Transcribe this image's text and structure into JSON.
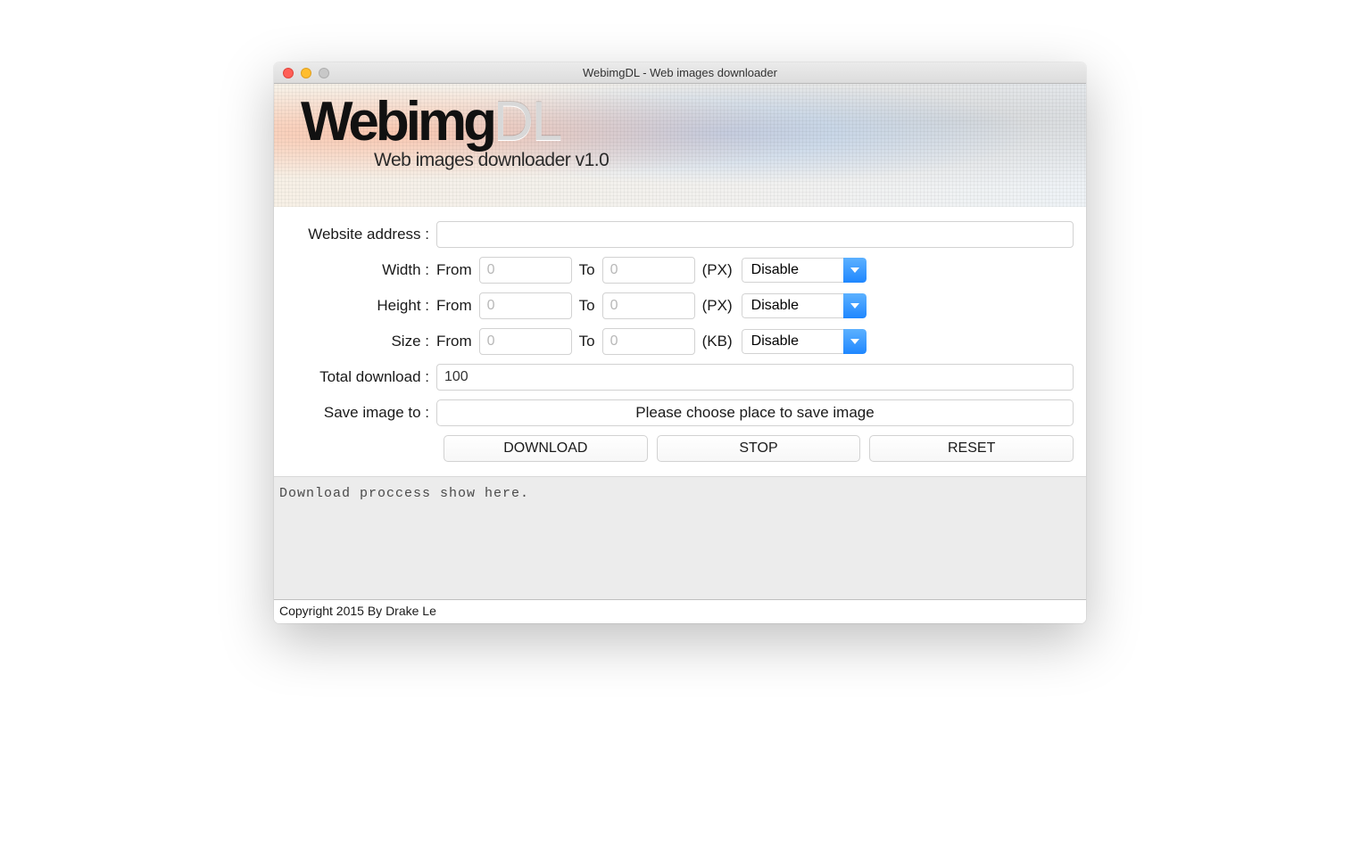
{
  "window": {
    "title": "WebimgDL - Web images downloader"
  },
  "banner": {
    "logo_part1": "Webimg",
    "logo_part2": "DL",
    "subtitle": "Web images downloader v1.0"
  },
  "form": {
    "website_label": "Website address :",
    "website_value": "",
    "width": {
      "label": "Width :",
      "from_label": "From",
      "from_placeholder": "0",
      "to_label": "To",
      "to_placeholder": "0",
      "unit": "(PX)",
      "select": "Disable"
    },
    "height": {
      "label": "Height :",
      "from_label": "From",
      "from_placeholder": "0",
      "to_label": "To",
      "to_placeholder": "0",
      "unit": "(PX)",
      "select": "Disable"
    },
    "size": {
      "label": "Size :",
      "from_label": "From",
      "from_placeholder": "0",
      "to_label": "To",
      "to_placeholder": "0",
      "unit": "(KB)",
      "select": "Disable"
    },
    "total": {
      "label": "Total download :",
      "value": "100"
    },
    "save": {
      "label": "Save image to :",
      "button": "Please choose place to save image"
    },
    "actions": {
      "download": "DOWNLOAD",
      "stop": "STOP",
      "reset": "RESET"
    }
  },
  "log": "Download proccess show here.",
  "footer": "Copyright 2015 By Drake Le"
}
